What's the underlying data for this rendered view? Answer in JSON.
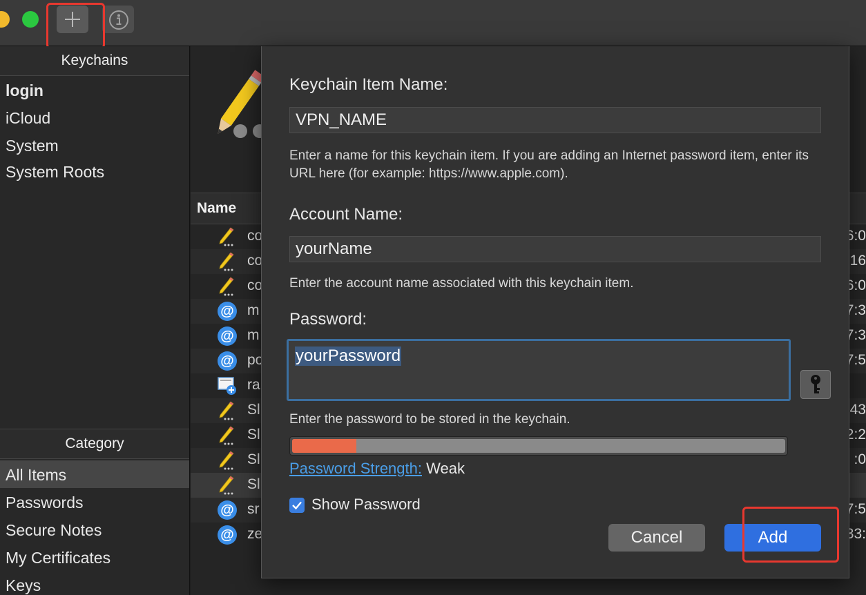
{
  "toolbar": {
    "add_icon": "plus-icon",
    "info_icon": "info-icon"
  },
  "sidebar": {
    "keychains_header": "Keychains",
    "keychains": [
      {
        "label": "login",
        "bold": true
      },
      {
        "label": "iCloud"
      },
      {
        "label": "System"
      },
      {
        "label": "System Roots"
      }
    ],
    "category_header": "Category",
    "categories": [
      {
        "label": "All Items",
        "selected": true
      },
      {
        "label": "Passwords"
      },
      {
        "label": "Secure Notes"
      },
      {
        "label": "My Certificates"
      },
      {
        "label": "Keys"
      }
    ]
  },
  "list": {
    "column_name": "Name",
    "rows": [
      {
        "icon": "note-icon",
        "name": "co",
        "tail": "6:0"
      },
      {
        "icon": "note-icon",
        "name": "co",
        "tail": "16"
      },
      {
        "icon": "note-icon",
        "name": "co",
        "tail": "6:0"
      },
      {
        "icon": "at-icon",
        "name": "m",
        "tail": "7:3"
      },
      {
        "icon": "at-icon",
        "name": "m",
        "tail": "7:3"
      },
      {
        "icon": "at-icon",
        "name": "po",
        "tail": "7:5"
      },
      {
        "icon": "certificate-icon",
        "name": "ra",
        "tail": ""
      },
      {
        "icon": "note-icon",
        "name": "Sl",
        "tail": ":43"
      },
      {
        "icon": "note-icon",
        "name": "Sl",
        "tail": "2:2"
      },
      {
        "icon": "note-icon",
        "name": "Sl",
        "tail": ":0"
      },
      {
        "icon": "note-icon",
        "name": "Sl",
        "tail": ""
      },
      {
        "icon": "at-icon",
        "name": "sr",
        "tail": "7:5"
      },
      {
        "icon": "at-icon",
        "name": "ze",
        "tail": "33:"
      }
    ],
    "at_glyph": "@"
  },
  "dialog": {
    "item_name_label": "Keychain Item Name:",
    "item_name_value": "VPN_NAME",
    "item_name_help": "Enter a name for this keychain item. If you are adding an Internet password item, enter its URL here (for example: https://www.apple.com).",
    "account_label": "Account Name:",
    "account_value": "yourName",
    "account_help": "Enter the account name associated with this keychain item.",
    "password_label": "Password:",
    "password_value": "yourPassword",
    "password_help": "Enter the password to be stored in the keychain.",
    "strength_link": "Password Strength:",
    "strength_value": "Weak",
    "strength_fraction": 0.13,
    "show_password_label": "Show Password",
    "show_password_checked": true,
    "cancel_label": "Cancel",
    "add_label": "Add",
    "key_icon": "key-icon"
  },
  "colors": {
    "accent": "#2f6fe0",
    "highlight_box": "#e8382f",
    "weak": "#ea6a4a",
    "link": "#4a9ee8"
  }
}
